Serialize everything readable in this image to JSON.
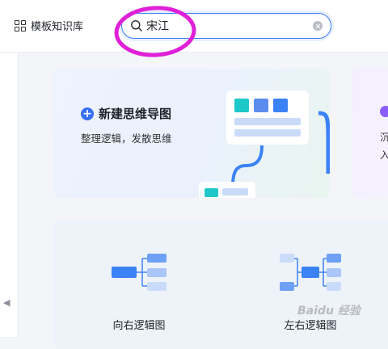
{
  "header": {
    "template_library_label": "模板知识库",
    "search": {
      "value": "宋江",
      "placeholder": ""
    }
  },
  "new_card": {
    "title": "新建思维导图",
    "description": "整理逻辑，发散思维"
  },
  "next_card": {
    "line1": "沉",
    "line2": "入"
  },
  "templates": [
    {
      "label": "向右逻辑图"
    },
    {
      "label": "左右逻辑图"
    }
  ],
  "watermark": "Baidu 经验",
  "icons": [
    "grid-icon",
    "search-icon",
    "clear-icon",
    "plus-icon",
    "collapse-arrow-icon"
  ],
  "colors": {
    "accent": "#3570f5",
    "annotation": "#e020d8",
    "teal": "#1ec8c8"
  }
}
